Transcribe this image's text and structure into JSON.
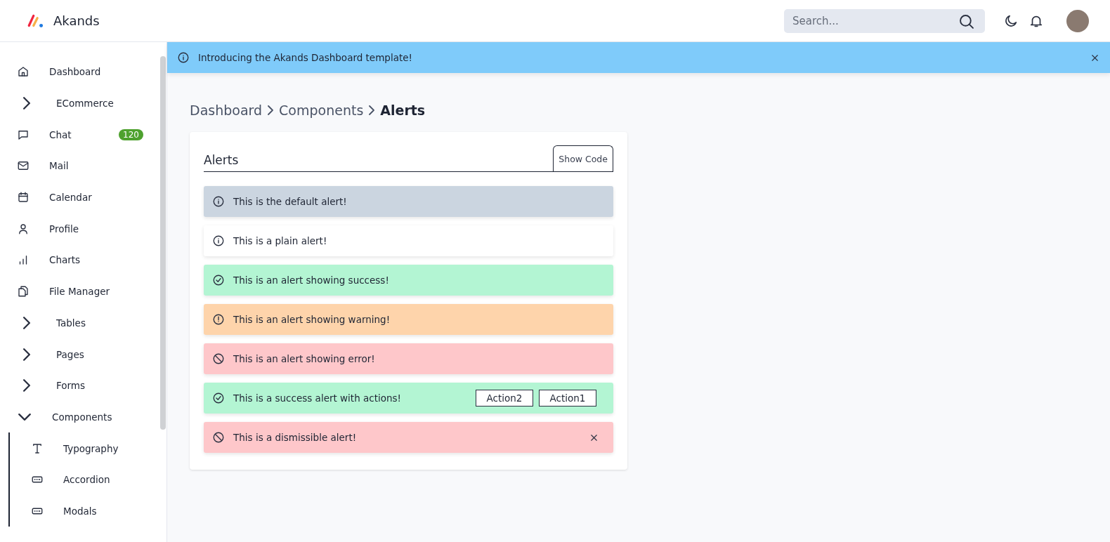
{
  "brand": {
    "name": "Akands"
  },
  "search": {
    "placeholder": "Search..."
  },
  "sidebar": {
    "items": [
      {
        "label": "Dashboard"
      },
      {
        "label": "ECommerce",
        "expanded": false
      },
      {
        "label": "Chat",
        "badge": "120"
      },
      {
        "label": "Mail"
      },
      {
        "label": "Calendar"
      },
      {
        "label": "Profile"
      },
      {
        "label": "Charts"
      },
      {
        "label": "File Manager"
      },
      {
        "label": "Tables",
        "expanded": false
      },
      {
        "label": "Pages",
        "expanded": false
      },
      {
        "label": "Forms",
        "expanded": false
      },
      {
        "label": "Components",
        "expanded": true,
        "children": [
          {
            "label": "Typography"
          },
          {
            "label": "Accordion"
          },
          {
            "label": "Modals"
          }
        ]
      }
    ]
  },
  "banner": {
    "text": "Introducing the Akands Dashboard template!"
  },
  "breadcrumb": [
    {
      "label": "Dashboard",
      "selected": false
    },
    {
      "label": "Components",
      "selected": false
    },
    {
      "label": "Alerts",
      "selected": true
    }
  ],
  "card": {
    "title": "Alerts",
    "button": "Show Code",
    "alerts": [
      {
        "kind": "default",
        "text": "This is the default alert!"
      },
      {
        "kind": "plain",
        "text": "This is a plain alert!"
      },
      {
        "kind": "success",
        "text": "This is an alert showing success!"
      },
      {
        "kind": "warning",
        "text": "This is an alert showing warning!"
      },
      {
        "kind": "error",
        "text": "This is an alert showing error!"
      },
      {
        "kind": "success",
        "text": "This is a success alert with actions!",
        "actions": [
          "Action2",
          "Action1"
        ]
      },
      {
        "kind": "error",
        "text": "This is a dismissible alert!",
        "dismissible": true
      }
    ]
  }
}
